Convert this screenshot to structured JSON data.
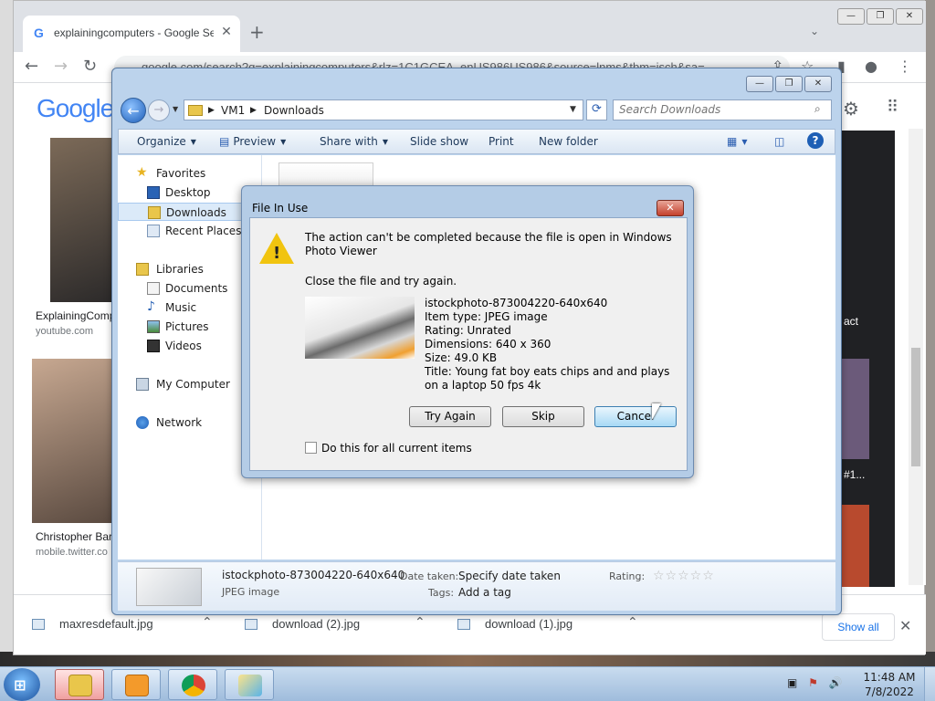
{
  "chrome": {
    "tab_title": "explainingcomputers - Google Se",
    "tab_favicon": "G",
    "url": "google.com/search?q=explainingcomputers&rlz=1C1GCEA_enUS986US986&source=lnms&tbm=isch&sa=",
    "google_logo": "Google",
    "results": [
      {
        "caption": "ExplainingComp",
        "source": "youtube.com"
      },
      {
        "caption": "Christopher Bar",
        "source": "mobile.twitter.co"
      }
    ],
    "right_labels": [
      "act",
      "#1..."
    ],
    "downloads": [
      {
        "name": "maxresdefault.jpg"
      },
      {
        "name": "download (2).jpg"
      },
      {
        "name": "download (1).jpg"
      }
    ],
    "show_all": "Show all"
  },
  "explorer": {
    "breadcrumb": [
      "VM1",
      "Downloads"
    ],
    "search_placeholder": "Search Downloads",
    "commands": {
      "organize": "Organize",
      "preview": "Preview",
      "share": "Share with",
      "slideshow": "Slide show",
      "print": "Print",
      "new_folder": "New folder"
    },
    "nav": {
      "favorites": "Favorites",
      "desktop": "Desktop",
      "downloads": "Downloads",
      "recent": "Recent Places",
      "libraries": "Libraries",
      "documents": "Documents",
      "music": "Music",
      "pictures": "Pictures",
      "videos": "Videos",
      "computer": "My Computer",
      "network": "Network"
    },
    "details": {
      "filename": "istockphoto-873004220-640x640",
      "type": "JPEG image",
      "date_label": "Date taken:",
      "date_value": "Specify date taken",
      "tags_label": "Tags:",
      "tags_value": "Add a tag",
      "rating_label": "Rating:",
      "rating_stars": "☆☆☆☆☆"
    }
  },
  "dialog": {
    "title": "File In Use",
    "message": "The action can't be completed because the file is open in Windows Photo Viewer",
    "instruction": "Close the file and try again.",
    "file": {
      "name": "istockphoto-873004220-640x640",
      "item_type": "Item type: JPEG image",
      "rating": "Rating: Unrated",
      "dimensions": "Dimensions: 640 x 360",
      "size": "Size: 49.0 KB",
      "title": "Title: Young fat boy eats chips and and plays on a laptop 50 fps 4k"
    },
    "buttons": {
      "try_again": "Try Again",
      "skip": "Skip",
      "cancel": "Cancel"
    },
    "checkbox_label": "Do this for all current items"
  },
  "taskbar": {
    "time": "11:48 AM",
    "date": "7/8/2022"
  }
}
